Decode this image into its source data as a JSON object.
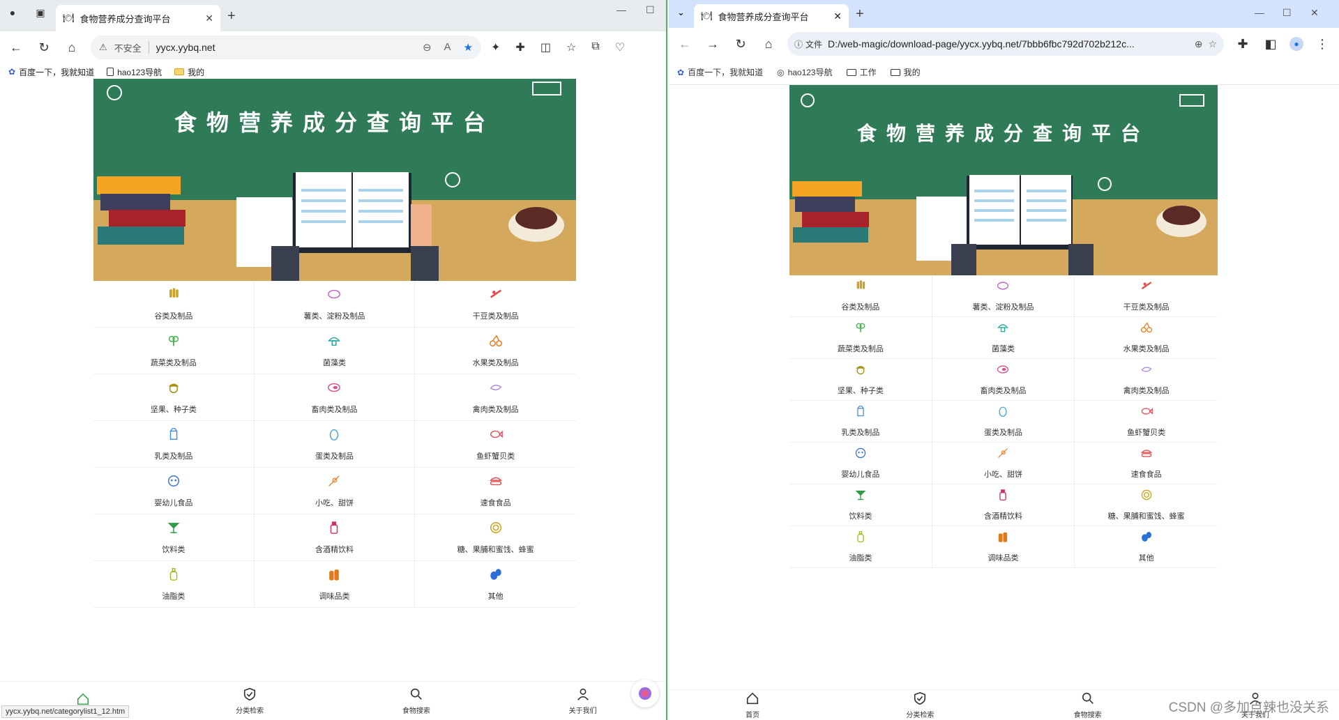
{
  "left": {
    "tab": {
      "title": "食物营养成分查询平台"
    },
    "omnibox": {
      "warning": "不安全",
      "url": "yycx.yybq.net"
    },
    "bookmarks": [
      "百度一下，我就知道",
      "hao123导航",
      "我的"
    ],
    "status_url": "yycx.yybq.net/categorylist1_12.htm"
  },
  "right": {
    "tab": {
      "title": "食物营养成分查询平台"
    },
    "omnibox": {
      "chip": "文件",
      "url": "D:/web-magic/download-page/yycx.yybq.net/7bbb6fbc792d702b212c..."
    },
    "bookmarks": [
      "百度一下，我就知道",
      "hao123导航",
      "工作",
      "我的"
    ]
  },
  "page": {
    "banner_title": "食物营养成分查询平台",
    "categories": [
      {
        "label": "谷类及制品",
        "icon": "wheat-icon",
        "color": "#c9a227"
      },
      {
        "label": "薯类、淀粉及制品",
        "icon": "potato-icon",
        "color": "#c45bd0"
      },
      {
        "label": "干豆类及制品",
        "icon": "bean-icon",
        "color": "#e05050"
      },
      {
        "label": "蔬菜类及制品",
        "icon": "broccoli-icon",
        "color": "#3fb24f"
      },
      {
        "label": "菌藻类",
        "icon": "mushroom-icon",
        "color": "#23a8a0"
      },
      {
        "label": "水果类及制品",
        "icon": "cherry-icon",
        "color": "#e87a1c"
      },
      {
        "label": "坚果、种子类",
        "icon": "nut-icon",
        "color": "#a8920f"
      },
      {
        "label": "畜肉类及制品",
        "icon": "meat-icon",
        "color": "#d9508c"
      },
      {
        "label": "禽肉类及制品",
        "icon": "poultry-icon",
        "color": "#b18ad8"
      },
      {
        "label": "乳类及制品",
        "icon": "milk-icon",
        "color": "#4c8fd8"
      },
      {
        "label": "蛋类及制品",
        "icon": "egg-icon",
        "color": "#4aa6d8"
      },
      {
        "label": "鱼虾蟹贝类",
        "icon": "fish-icon",
        "color": "#e0505c"
      },
      {
        "label": "婴幼儿食品",
        "icon": "baby-icon",
        "color": "#3f72d0"
      },
      {
        "label": "小吃、甜饼",
        "icon": "skewer-icon",
        "color": "#ea8a3a"
      },
      {
        "label": "速食食品",
        "icon": "burger-icon",
        "color": "#e05050"
      },
      {
        "label": "饮料类",
        "icon": "cocktail-icon",
        "color": "#2e9a4a"
      },
      {
        "label": "含酒精饮料",
        "icon": "bottle-icon",
        "color": "#c8306e"
      },
      {
        "label": "糖、果脯和蜜饯、蜂蜜",
        "icon": "candy-icon",
        "color": "#c9a215"
      },
      {
        "label": "油脂类",
        "icon": "oil-icon",
        "color": "#a8b820"
      },
      {
        "label": "调味品类",
        "icon": "condiment-icon",
        "color": "#e07a1a"
      },
      {
        "label": "其他",
        "icon": "olive-icon",
        "color": "#2b6fd6"
      }
    ],
    "tabbar": [
      {
        "label": "",
        "icon": "home-icon",
        "active": true
      },
      {
        "label": "分类检索",
        "icon": "shield-icon"
      },
      {
        "label": "食物搜索",
        "icon": "search-icon"
      },
      {
        "label": "关于我们",
        "icon": "user-icon"
      }
    ],
    "tabbar_right_home_label": "首页"
  },
  "watermark": "CSDN @多加点辣也没关系",
  "colors": {
    "banner": "#2f7b58",
    "desk": "#d4a95e",
    "tab_active": "#3aa64a"
  }
}
